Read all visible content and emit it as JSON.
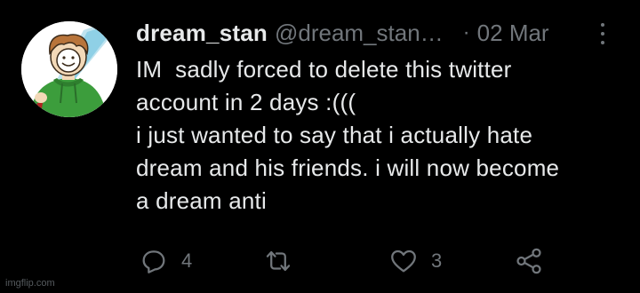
{
  "tweet": {
    "display_name": "dream_stan",
    "handle": "@dream_stan…",
    "separator": "·",
    "date": "02 Mar",
    "text_lines": [
      "IM  sadly forced to delete this twitter",
      "account in 2 days :(((",
      "i just wanted to say that i actually hate",
      "dream and his friends. i will now become",
      "a dream anti"
    ]
  },
  "actions": {
    "reply": {
      "icon": "reply-icon",
      "count": "4"
    },
    "retweet": {
      "icon": "retweet-icon",
      "count": ""
    },
    "like": {
      "icon": "heart-icon",
      "count": "3"
    },
    "share": {
      "icon": "share-icon"
    }
  },
  "more_icon": "more-vertical-icon",
  "watermark": "imgflip.com",
  "colors": {
    "background": "#000000",
    "primary_text": "#e7e9ea",
    "secondary_text": "#71767b"
  }
}
